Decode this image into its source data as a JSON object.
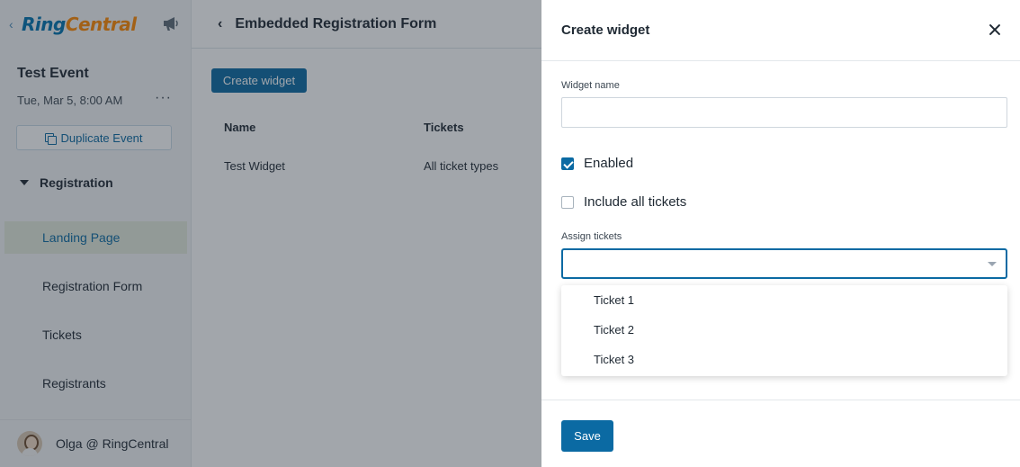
{
  "sidebar": {
    "logo_ring": "Ring",
    "logo_central": "Central",
    "event_title": "Test Event",
    "event_date": "Tue, Mar 5, 8:00 AM",
    "more_label": "···",
    "duplicate_label": "Duplicate Event",
    "section_label": "Registration",
    "items": [
      {
        "label": "Landing Page"
      },
      {
        "label": "Registration Form"
      },
      {
        "label": "Tickets"
      },
      {
        "label": "Registrants"
      }
    ],
    "user_name": "Olga @ RingCentral"
  },
  "main": {
    "title": "Embedded Registration Form",
    "back_label": "‹",
    "create_label": "Create widget",
    "columns": [
      "Name",
      "Tickets"
    ],
    "rows": [
      {
        "name": "Test Widget",
        "tickets": "All ticket types"
      }
    ]
  },
  "drawer": {
    "title": "Create widget",
    "widget_name_label": "Widget name",
    "widget_name_value": "",
    "enabled_label": "Enabled",
    "enabled_checked": true,
    "include_all_label": "Include all tickets",
    "include_all_checked": false,
    "assign_label": "Assign tickets",
    "assign_value": "",
    "options": [
      "Ticket 1",
      "Ticket 2",
      "Ticket 3"
    ],
    "save_label": "Save"
  },
  "colors": {
    "brand_blue": "#0b6aa3",
    "logo_orange": "#ff8800",
    "active_nav_bg": "#e3ebdd"
  }
}
